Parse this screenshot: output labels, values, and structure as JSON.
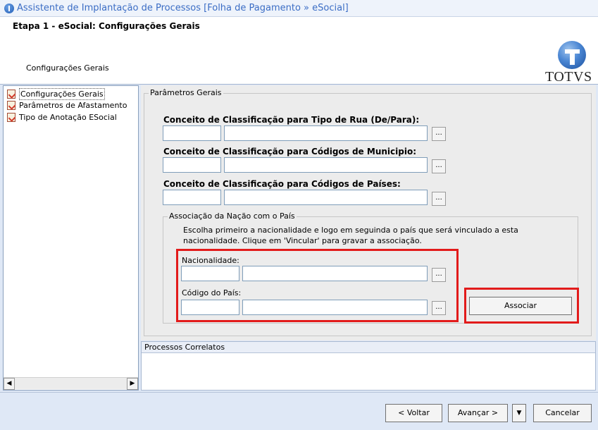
{
  "window": {
    "title": "Assistente de Implantação de Processos [Folha de Pagamento » eSocial]"
  },
  "header": {
    "step_title": "Etapa 1 - eSocial: Configurações Gerais",
    "step_subtitle": "Configurações Gerais",
    "logo_text": "TOTVS"
  },
  "tree": {
    "items": [
      {
        "label": "Configurações Gerais",
        "selected": true
      },
      {
        "label": "Parâmetros de Afastamento",
        "selected": false
      },
      {
        "label": "Tipo de Anotação ESocial",
        "selected": false
      }
    ]
  },
  "params": {
    "group_title": "Parâmetros Gerais",
    "fields": [
      {
        "label": "Conceito de Classificação para Tipo de Rua (De/Para):",
        "code": "",
        "description": "",
        "browse": "..."
      },
      {
        "label": "Conceito de Classificação para Códigos de Municipio:",
        "code": "",
        "description": "",
        "browse": "..."
      },
      {
        "label": "Conceito de Classificação para Códigos de Países:",
        "code": "",
        "description": "",
        "browse": "..."
      }
    ]
  },
  "association": {
    "group_title": "Associação da Nação com o País",
    "instructions": [
      "Escolha primeiro a nacionalidade e logo em seguinda o país que será vinculado a esta",
      "nacionalidade. Clique em 'Vincular' para gravar a associação."
    ],
    "nationality_label": "Nacionalidade:",
    "country_label": "Código do País:",
    "browse": "...",
    "associate_button": "Associar"
  },
  "lower": {
    "title": "Processos Correlatos"
  },
  "footer": {
    "back": "< Voltar",
    "next": "Avançar >",
    "dropdown": "▼",
    "cancel": "Cancelar"
  },
  "colors": {
    "highlight": "#e21b1b",
    "title_text": "#3b6dc5"
  }
}
